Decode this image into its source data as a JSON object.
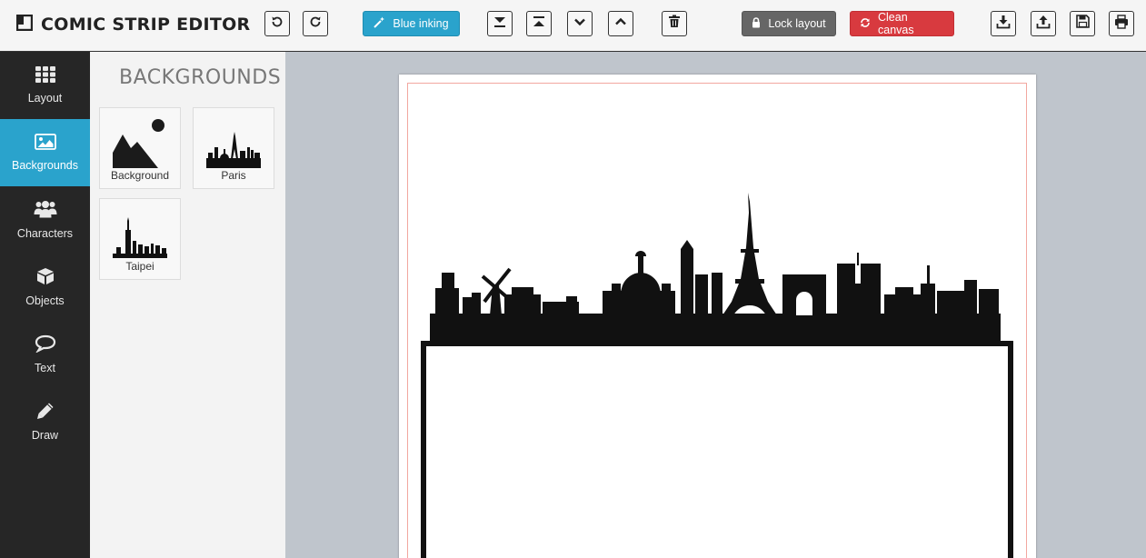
{
  "app": {
    "title": "COMIC STRIP EDITOR"
  },
  "toolbar": {
    "blue_inking_label": "Blue inking",
    "lock_layout_label": "Lock layout",
    "clean_canvas_label": "Clean canvas",
    "icons": [
      "undo-icon",
      "redo-icon",
      "magic-wand-icon",
      "send-to-back-icon",
      "bring-to-front-icon",
      "send-backward-icon",
      "bring-forward-icon",
      "trash-icon",
      "lock-icon",
      "refresh-icon",
      "download-icon",
      "upload-icon",
      "save-icon",
      "print-icon"
    ]
  },
  "sidebar": {
    "items": [
      {
        "label": "Layout",
        "icon": "grid-icon"
      },
      {
        "label": "Backgrounds",
        "icon": "image-icon",
        "active": true
      },
      {
        "label": "Characters",
        "icon": "users-icon"
      },
      {
        "label": "Objects",
        "icon": "cube-icon"
      },
      {
        "label": "Text",
        "icon": "speech-bubble-icon"
      },
      {
        "label": "Draw",
        "icon": "pencil-icon"
      }
    ]
  },
  "panel": {
    "title": "BACKGROUNDS",
    "tiles": [
      {
        "label": "Background"
      },
      {
        "label": "Paris"
      },
      {
        "label": "Taipei"
      }
    ]
  },
  "colors": {
    "accent": "#2aa3cc",
    "danger": "#d83a3f",
    "neutral": "#666666",
    "sidebar": "#262626",
    "canvas_bg": "#bfc5cc"
  }
}
